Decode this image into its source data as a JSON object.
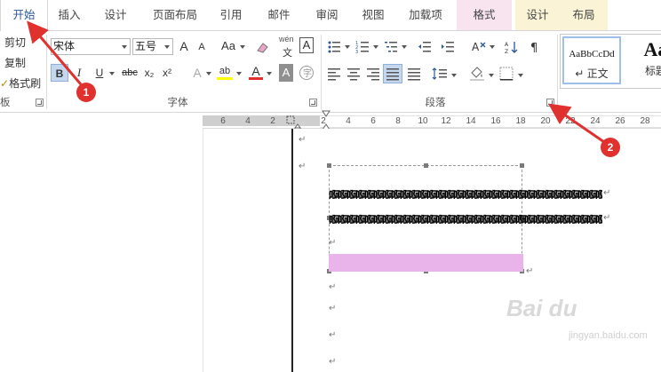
{
  "tabs": [
    "开始",
    "插入",
    "设计",
    "页面布局",
    "引用",
    "邮件",
    "审阅",
    "视图",
    "加载项",
    "格式",
    "设计",
    "布局"
  ],
  "clipboard": {
    "cut": "剪切",
    "copy": "复制",
    "format_painter": "格式刷",
    "group_label": "板"
  },
  "font": {
    "name": "宋体",
    "size": "五号",
    "group_label": "字体",
    "grow_label": "A",
    "shrink_label": "A",
    "case_label": "Aa",
    "bold_label": "B",
    "italic_label": "I",
    "underline_label": "U",
    "strike_label": "abc",
    "sub_label": "x₂",
    "sup_label": "x²",
    "color_a_label": "A",
    "highlight_label": "ab",
    "pinyin_top": "wén",
    "pinyin_bottom": "文",
    "border_label": "A"
  },
  "paragraph": {
    "group_label": "段落"
  },
  "styles": [
    {
      "preview": "AaBbCcDd",
      "name": "↵ 正文"
    },
    {
      "preview": "Aa",
      "name": "标题"
    }
  ],
  "ruler_ticks": [
    "6",
    "4",
    "2",
    "2",
    "4",
    "6",
    "8",
    "10",
    "12",
    "14",
    "16",
    "18",
    "20",
    "22",
    "24",
    "26",
    "28"
  ],
  "document": {
    "line1": "啊啊啊啊啊啊啊啊啊啊啊啊啊啊啊啊啊啊啊啊啊啊啊啊啊啊啊啊啊啊啊啊",
    "line2": "啊啊啊啊啊啊啊啊啊啊啊啊啊啊啊啊啊啊啊啊啊啊啊啊啊啊啊啊啊啊啊啊",
    "para_mark": "↵"
  },
  "annotations": {
    "badge1": "1",
    "badge2": "2"
  },
  "watermark": {
    "main": "Bai du",
    "sub": "jingyan.baidu.com"
  },
  "colors": {
    "accent": "#2b579a",
    "annotation": "#e0312e",
    "highlight_fill": "#e9b4e9",
    "font_color": "#e0312e",
    "highlight_color": "#ffff00"
  }
}
